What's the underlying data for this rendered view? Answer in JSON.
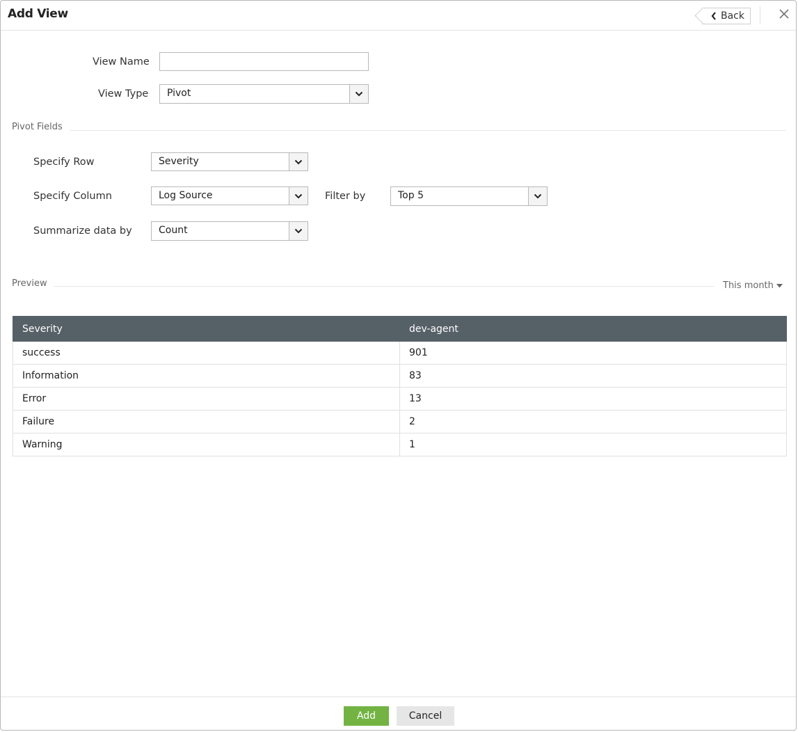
{
  "dialog": {
    "title": "Add View",
    "back_label": "Back"
  },
  "form": {
    "view_name_label": "View Name",
    "view_name_value": "",
    "view_type_label": "View Type",
    "view_type_value": "Pivot"
  },
  "pivot": {
    "section_title": "Pivot Fields",
    "row_label": "Specify Row",
    "row_value": "Severity",
    "column_label": "Specify Column",
    "column_value": "Log Source",
    "filter_label": "Filter by",
    "filter_value": "Top 5",
    "summarize_label": "Summarize data by",
    "summarize_value": "Count"
  },
  "preview": {
    "section_title": "Preview",
    "range_label": "This month",
    "columns": [
      "Severity",
      "dev-agent"
    ],
    "rows": [
      [
        "success",
        "901"
      ],
      [
        "Information",
        "83"
      ],
      [
        "Error",
        "13"
      ],
      [
        "Failure",
        "2"
      ],
      [
        "Warning",
        "1"
      ]
    ]
  },
  "footer": {
    "add_label": "Add",
    "cancel_label": "Cancel"
  },
  "colors": {
    "table_header_bg": "#566067",
    "add_button_bg": "#72b343",
    "cancel_button_bg": "#e6e6e6"
  },
  "icons": {
    "back": "chevron-left-icon",
    "close": "close-icon",
    "dropdown": "chevron-down-icon",
    "range": "caret-down-icon"
  }
}
